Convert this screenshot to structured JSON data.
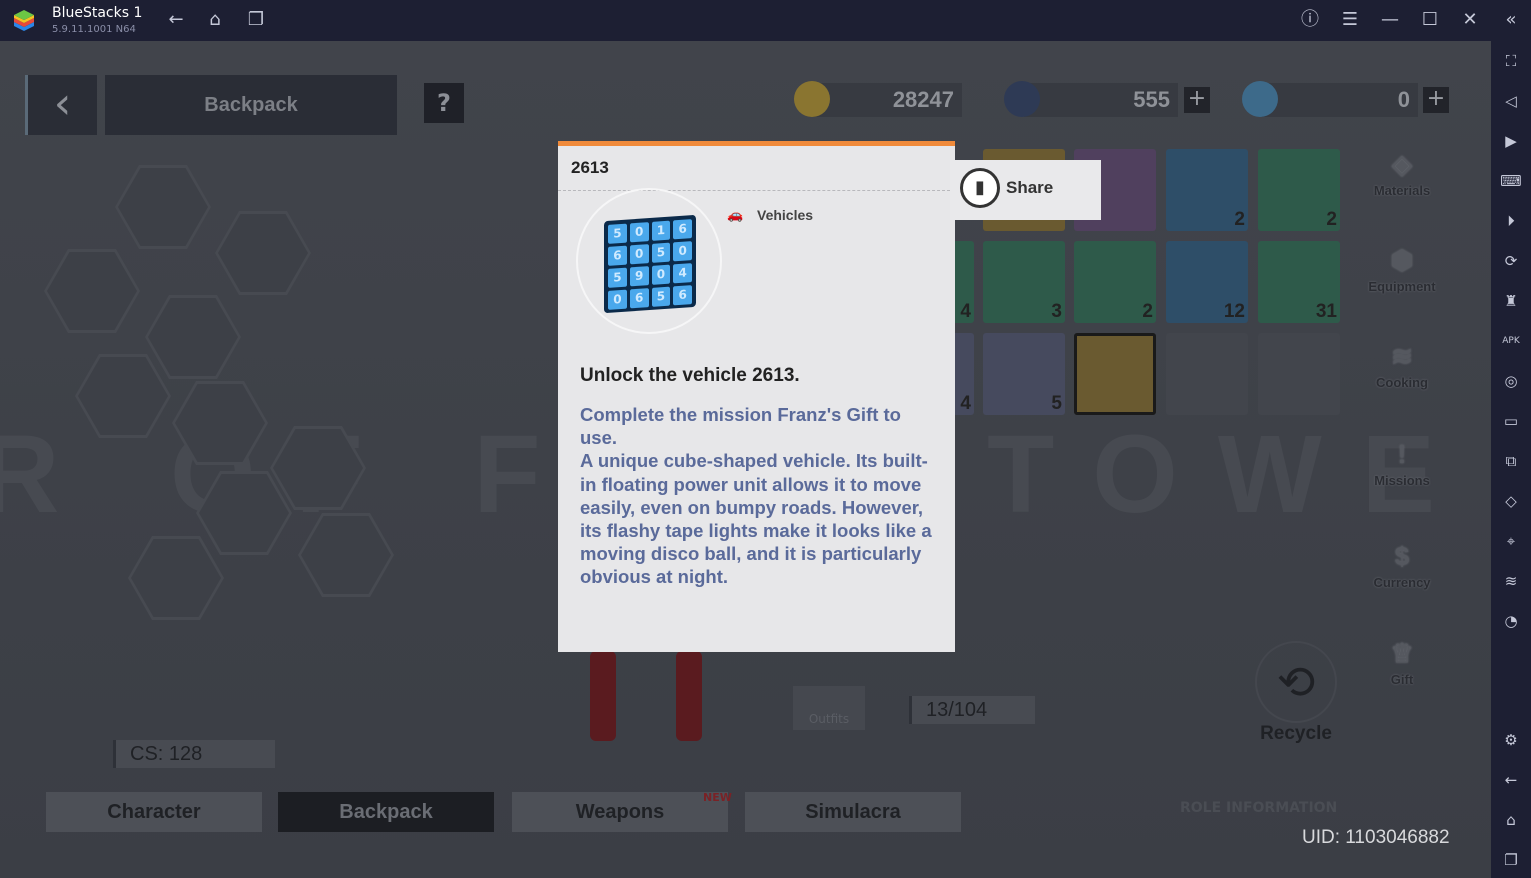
{
  "titlebar": {
    "app_name": "BlueStacks 1",
    "version": "5.9.11.1001 N64",
    "icons": [
      "back-arrow-icon",
      "home-icon",
      "multi-instance-icon",
      "help-icon",
      "menu-icon",
      "minimize-icon",
      "maximize-icon",
      "close-icon",
      "collapse-sidebar-icon"
    ]
  },
  "sidebar": {
    "icons": [
      "fullscreen-icon",
      "volume-icon",
      "media-icon",
      "keyboard-icon",
      "macro-icon",
      "rotate-icon",
      "gamepad-icon",
      "apk-icon",
      "screenshot-icon",
      "folder-icon",
      "multi-window-icon",
      "eraser-icon",
      "location-icon",
      "layers-icon",
      "performance-icon",
      "settings-icon",
      "back-icon",
      "home-icon",
      "recent-apps-icon"
    ]
  },
  "game": {
    "header": {
      "title": "Backpack",
      "help": "?"
    },
    "currency": {
      "gold": "28247",
      "gems": "555",
      "crystals": "0"
    },
    "inventory": {
      "counts": [
        "2",
        "2",
        "4",
        "3",
        "2",
        "12",
        "31",
        "4",
        "5"
      ]
    },
    "menu": [
      "Materials",
      "Equipment",
      "Cooking",
      "Missions",
      "Currency",
      "Gift"
    ],
    "recycle": "Recycle",
    "capacity": "13/104",
    "outfits": "Outfits",
    "cs": "CS: 128",
    "tabs": [
      {
        "label": "Character"
      },
      {
        "label": "Backpack",
        "active": true
      },
      {
        "label": "Weapons",
        "badge": "NEW"
      },
      {
        "label": "Simulacra"
      }
    ],
    "role_info": "ROLE INFORMATION",
    "uid": "UID: 1103046882"
  },
  "popup": {
    "title": "2613",
    "category": "Vehicles",
    "cube_digits": [
      "5",
      "0",
      "1",
      "6",
      "6",
      "0",
      "5",
      "0",
      "5",
      "9",
      "0",
      "4",
      "0",
      "6",
      "5",
      "6"
    ],
    "headline": "Unlock the vehicle 2613.",
    "description": "Complete the mission Franz's Gift to use.\nA unique cube-shaped vehicle. Its built-in floating power unit allows it to move easily, even on bumpy roads. However, its flashy tape lights make it looks like a moving disco ball, and it is particularly obvious at night.",
    "share": "Share",
    "accent": "#f08a3a"
  }
}
